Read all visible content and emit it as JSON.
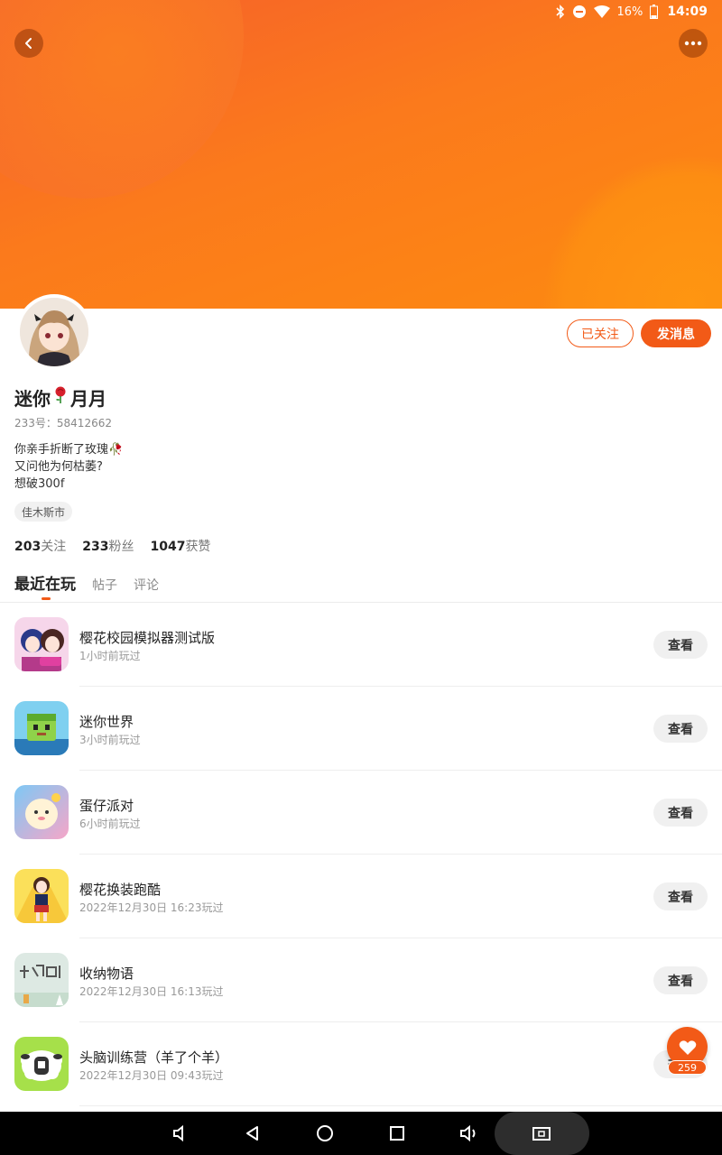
{
  "status_bar": {
    "battery": "16%",
    "time": "14:09"
  },
  "profile": {
    "name_part1": "迷你",
    "name_part2": "月月",
    "uid": "233号：58412662",
    "bio": [
      "你亲手折断了玫瑰🥀",
      "又问他为何枯萎?",
      "想破300f"
    ],
    "location": "佳木斯市",
    "follow_button": "已关注",
    "message_button": "发消息"
  },
  "stats": {
    "following_count": "203",
    "following_label": "关注",
    "fans_count": "233",
    "fans_label": "粉丝",
    "likes_count": "1047",
    "likes_label": "获赞"
  },
  "tabs": [
    "最近在玩",
    "帖子",
    "评论"
  ],
  "games": [
    {
      "name": "樱花校园模拟器测试版",
      "time": "1小时前玩过",
      "action": "查看"
    },
    {
      "name": "迷你世界",
      "time": "3小时前玩过",
      "action": "查看"
    },
    {
      "name": "蛋仔派对",
      "time": "6小时前玩过",
      "action": "查看"
    },
    {
      "name": "樱花换装跑酷",
      "time": "2022年12月30日 16:23玩过",
      "action": "查看"
    },
    {
      "name": "收纳物语",
      "time": "2022年12月30日 16:13玩过",
      "action": "查看"
    },
    {
      "name": "头脑训练营（羊了个羊）",
      "time": "2022年12月30日 09:43玩过",
      "action": "查看"
    }
  ],
  "like_fab": {
    "count": "259"
  },
  "colors": {
    "accent": "#f25a17",
    "banner": "#fb7a1c"
  }
}
